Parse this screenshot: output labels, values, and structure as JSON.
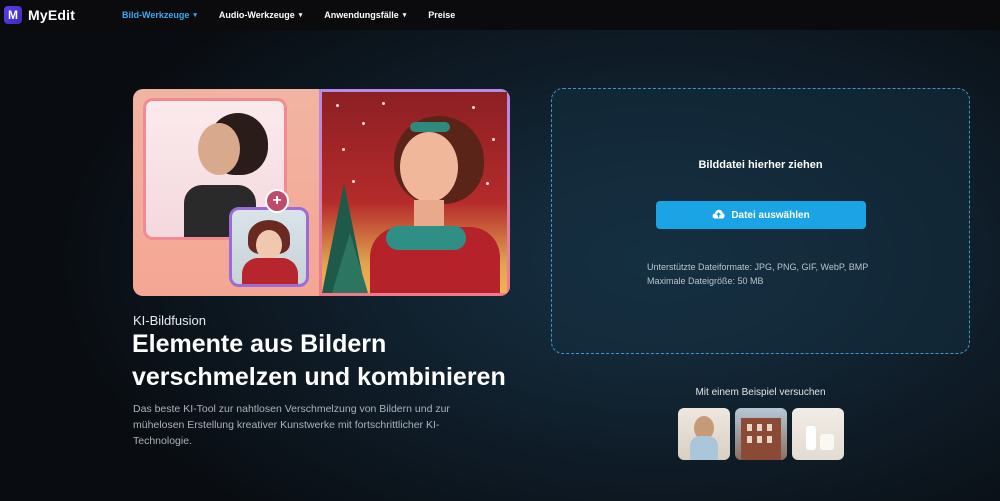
{
  "app": {
    "logo_letter": "M",
    "name": "MyEdit"
  },
  "nav": {
    "items": [
      {
        "label": "Bild-Werkzeuge",
        "has_dropdown": true,
        "active": true
      },
      {
        "label": "Audio-Werkzeuge",
        "has_dropdown": true,
        "active": false
      },
      {
        "label": "Anwendungsfälle",
        "has_dropdown": true,
        "active": false
      },
      {
        "label": "Preise",
        "has_dropdown": false,
        "active": false
      }
    ],
    "chevron": "▾"
  },
  "hero": {
    "eyebrow": "KI-Bildfusion",
    "title": "Elemente aus Bildern verschmelzen und kombinieren",
    "description": "Das beste KI-Tool zur nahtlosen Verschmelzung von Bildern und zur mühelosen Erstellung kreativer Kunstwerke mit fortschrittlicher KI-Technologie."
  },
  "collage": {
    "plus_symbol": "+"
  },
  "upload": {
    "drop_title": "Bilddatei hierher ziehen",
    "button_label": "Datei auswählen",
    "button_icon": "cloud-upload-icon",
    "formats_line": "Unterstützte Dateiformate: JPG, PNG, GIF, WebP, BMP",
    "size_line": "Maximale Dateigröße: 50 MB"
  },
  "samples": {
    "label": "Mit einem Beispiel versuchen",
    "items": [
      "woman-portrait",
      "city-buildings",
      "product-bottles"
    ]
  },
  "colors": {
    "accent": "#1aa4e6",
    "nav_active": "#3aa9f4",
    "dropzone_border": "#3e95c9"
  }
}
